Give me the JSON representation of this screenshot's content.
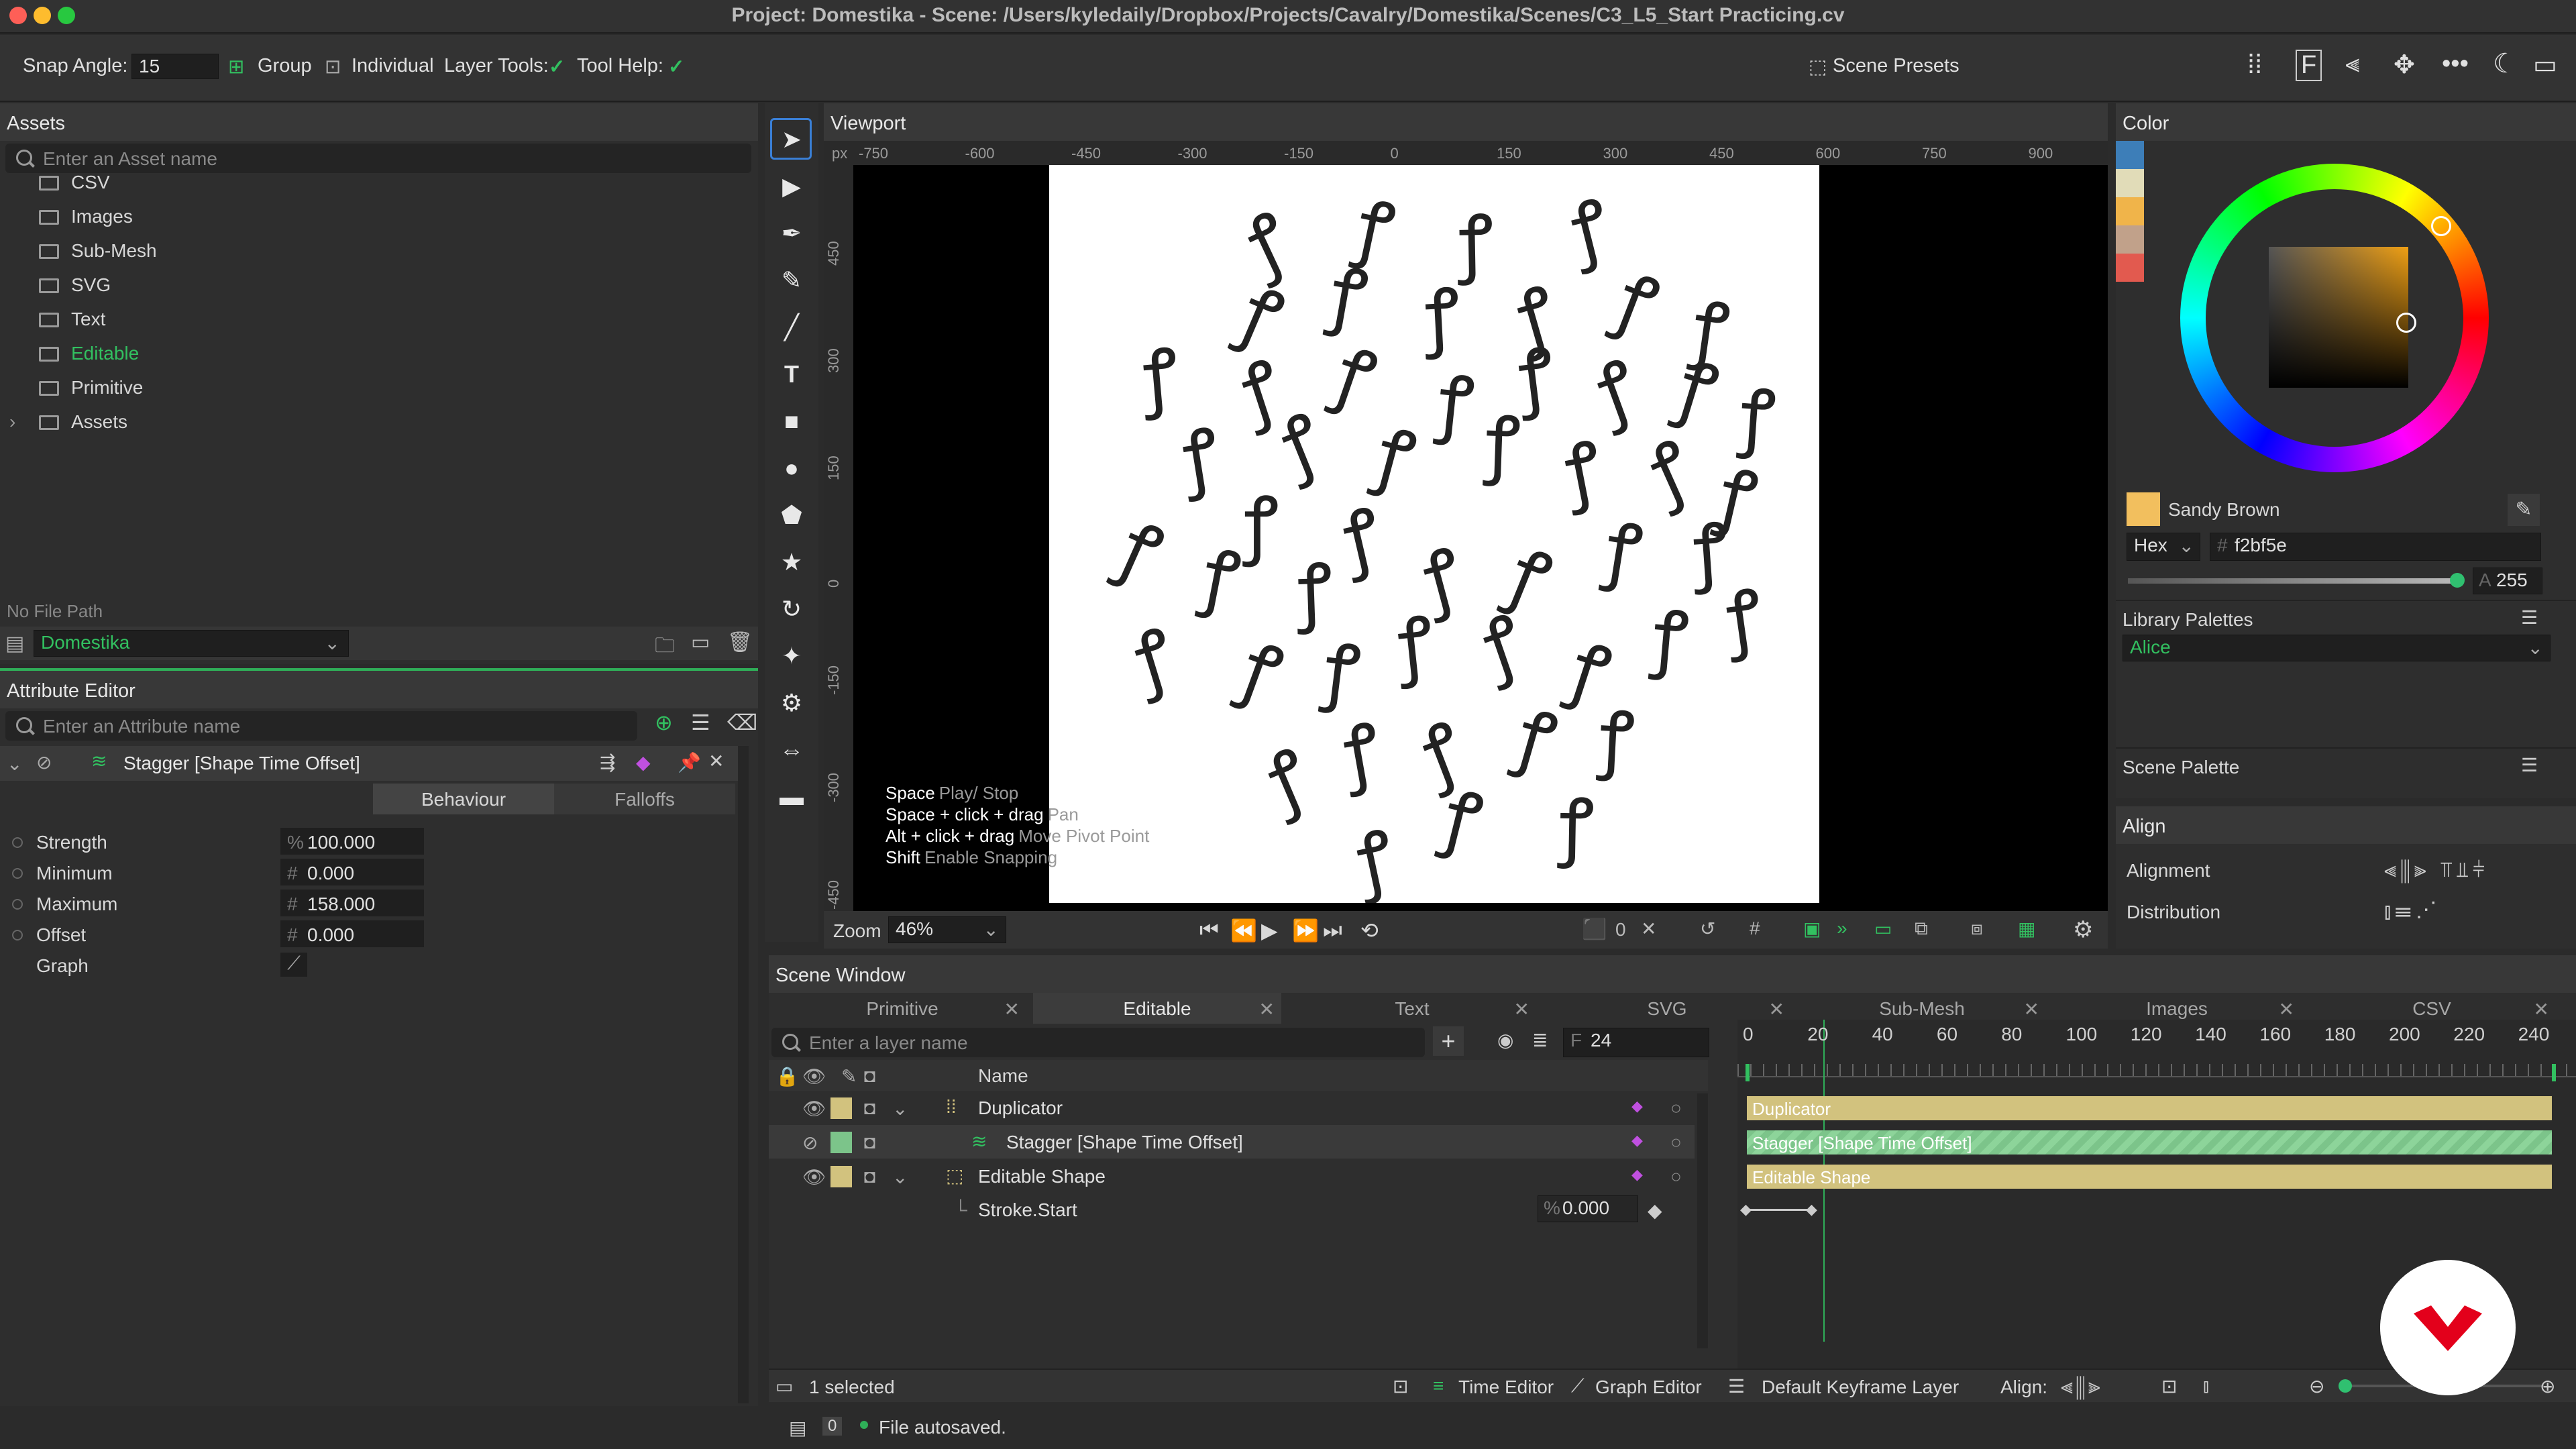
{
  "window": {
    "title": "Project: Domestika - Scene: /Users/kyledaily/Dropbox/Projects/Cavalry/Domestika/Scenes/C3_L5_Start Practicing.cv"
  },
  "toolbar": {
    "snap_label": "Snap Angle:",
    "snap_value": "15",
    "group_label": "Group",
    "individual_label": "Individual",
    "layer_tools_label": "Layer Tools:",
    "tool_help_label": "Tool Help:",
    "scene_presets_label": "Scene Presets"
  },
  "assets": {
    "header": "Assets",
    "search_placeholder": "Enter an Asset name",
    "items": [
      {
        "label": "CSV",
        "highlight": false
      },
      {
        "label": "Images",
        "highlight": false
      },
      {
        "label": "Sub-Mesh",
        "highlight": false
      },
      {
        "label": "SVG",
        "highlight": false
      },
      {
        "label": "Text",
        "highlight": false
      },
      {
        "label": "Editable",
        "highlight": true
      },
      {
        "label": "Primitive",
        "highlight": false
      },
      {
        "label": "Assets",
        "highlight": false
      }
    ],
    "file_path": "No File Path",
    "project": "Domestika"
  },
  "attribute_editor": {
    "header": "Attribute Editor",
    "search_placeholder": "Enter an Attribute name",
    "layer_title": "Stagger [Shape Time Offset]",
    "tabs": [
      "Behaviour",
      "Falloffs"
    ],
    "rows": [
      {
        "label": "Strength",
        "prefix": "%",
        "value": "100.000"
      },
      {
        "label": "Minimum",
        "prefix": "#",
        "value": "0.000"
      },
      {
        "label": "Maximum",
        "prefix": "#",
        "value": "158.000"
      },
      {
        "label": "Offset",
        "prefix": "#",
        "value": "0.000"
      }
    ],
    "graph_label": "Graph"
  },
  "viewport": {
    "header": "Viewport",
    "unit": "px",
    "hruler": [
      "-750",
      "-600",
      "-450",
      "-300",
      "-150",
      "0",
      "150",
      "300",
      "450",
      "600",
      "750",
      "900"
    ],
    "vruler": [
      "450",
      "300",
      "150",
      "0",
      "-150",
      "-300",
      "-450"
    ],
    "glyph": "ꝭ",
    "help": [
      {
        "key": "Space",
        "desc": "Play/ Stop"
      },
      {
        "key": "Space + click + drag",
        "desc": "Pan"
      },
      {
        "key": "Alt + click + drag",
        "desc": "Move Pivot Point"
      },
      {
        "key": "Shift",
        "desc": "Enable Snapping"
      }
    ],
    "zoom_label": "Zoom",
    "zoom_value": "46%",
    "frame_value": "0"
  },
  "color": {
    "header": "Color",
    "name": "Sandy Brown",
    "mode": "Hex",
    "hex": "f2bf5e",
    "alpha": "255",
    "swatch": "#f2bf5e",
    "library_label": "Library Palettes",
    "palette_name": "Alice",
    "palette": [
      "#3d7eb8",
      "#e1dcb8",
      "#f0b44a",
      "#c1a18a",
      "#e25a4f"
    ],
    "scene_palette_label": "Scene Palette"
  },
  "align": {
    "header": "Align",
    "alignment_label": "Alignment",
    "distribution_label": "Distribution"
  },
  "scene": {
    "header": "Scene Window",
    "tabs": [
      "Primitive",
      "Editable",
      "Text",
      "SVG",
      "Sub-Mesh",
      "Images",
      "CSV"
    ],
    "search_placeholder": "Enter a layer name",
    "frame_prefix": "F",
    "frame": "24",
    "name_col": "Name",
    "layers": [
      {
        "name": "Duplicator",
        "color": "#d2c27e",
        "indent": 0
      },
      {
        "name": "Stagger [Shape Time Offset]",
        "color": "#7cc48a",
        "indent": 1
      },
      {
        "name": "Editable Shape",
        "color": "#d2c27e",
        "indent": 0
      }
    ],
    "stroke_label": "Stroke.Start",
    "stroke_value": "0.000",
    "stroke_prefix": "%",
    "ticks": [
      "0",
      "20",
      "40",
      "60",
      "80",
      "100",
      "120",
      "140",
      "160",
      "180",
      "200",
      "220",
      "240"
    ],
    "bars": [
      "Duplicator",
      "Stagger [Shape Time Offset]",
      "Editable Shape"
    ],
    "selected": "1 selected",
    "time_editor": "Time Editor",
    "graph_editor": "Graph Editor",
    "keyframe_layer": "Default Keyframe Layer",
    "align_label": "Align:"
  },
  "status": {
    "count": "0",
    "message": "File autosaved."
  }
}
